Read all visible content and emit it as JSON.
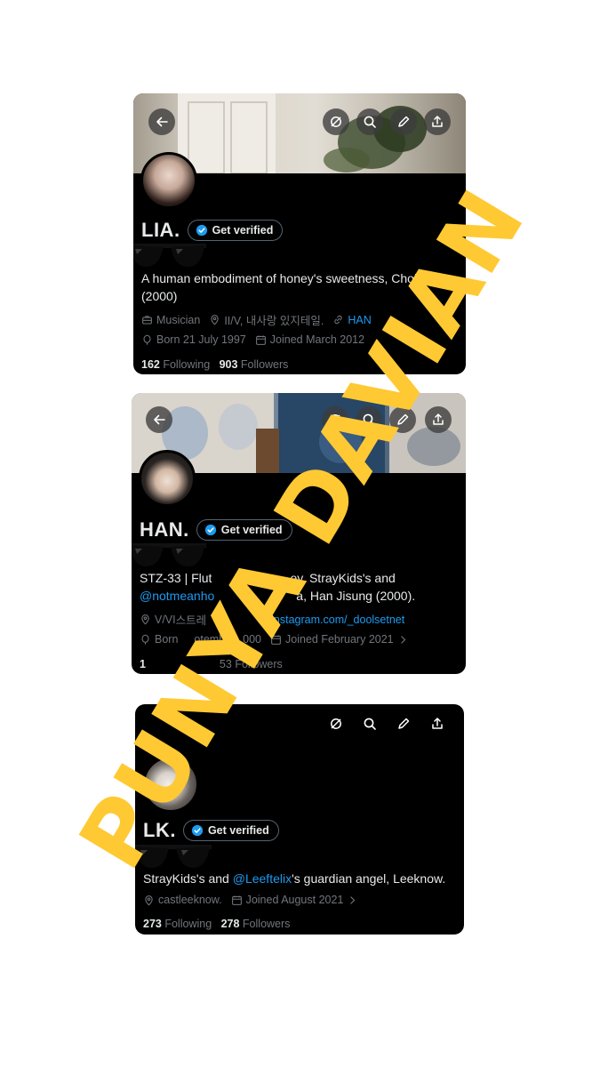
{
  "profiles": [
    {
      "name": "LIA.",
      "verify_label": "Get verified",
      "bio": "A human embodiment of honey's sweetness, Choi",
      "bio_line2": "(2000)",
      "profession": "Musician",
      "location": "II/V, 내사랑 있지테일.",
      "link": "HAN",
      "born": "Born 21 July 1997",
      "joined": "Joined March 2012",
      "following_count": "162",
      "following_label": "Following",
      "followers_count": "903",
      "followers_label": "Followers"
    },
    {
      "name": "HAN.",
      "verify_label": "Get verified",
      "bio": "STZ-33 | Flut",
      "bio_mid": "ey, StrayKids's and",
      "bio_mention": "@notmeanho",
      "bio_end": "a, Han Jisung (2000).",
      "location": "V/VI",
      "location_tail": "스트레",
      "link": "instagram.com/_doolsetnet",
      "born": "Born",
      "born_tail": "otemb",
      "born_year": "000",
      "joined": "Joined February 2021",
      "following_count": "1",
      "followers_count": "53",
      "followers_label": "Followers"
    },
    {
      "name": "LK.",
      "verify_label": "Get verified",
      "bio_start": "StrayKids's and ",
      "bio_mention": "@Leeftelix",
      "bio_end": "'s guardian angel, Leeknow.",
      "location": "castleeknow.",
      "joined": "Joined August 2021",
      "following_count": "273",
      "following_label": "Following",
      "followers_count": "278",
      "followers_label": "Followers"
    }
  ],
  "watermark": "PUNYA DAVIAN",
  "icons": [
    "back-arrow-icon",
    "mute-icon",
    "search-icon",
    "edit-pencil-icon",
    "share-icon",
    "verified-badge-icon",
    "briefcase-icon",
    "location-pin-icon",
    "link-icon",
    "balloon-icon",
    "calendar-icon",
    "chevron-right-icon",
    "sunglasses-emoji"
  ],
  "colors": {
    "accent": "#1d9bf0",
    "background": "#000000",
    "text": "#e7e9ea",
    "muted": "#71767b",
    "watermark": "#ffc933"
  }
}
